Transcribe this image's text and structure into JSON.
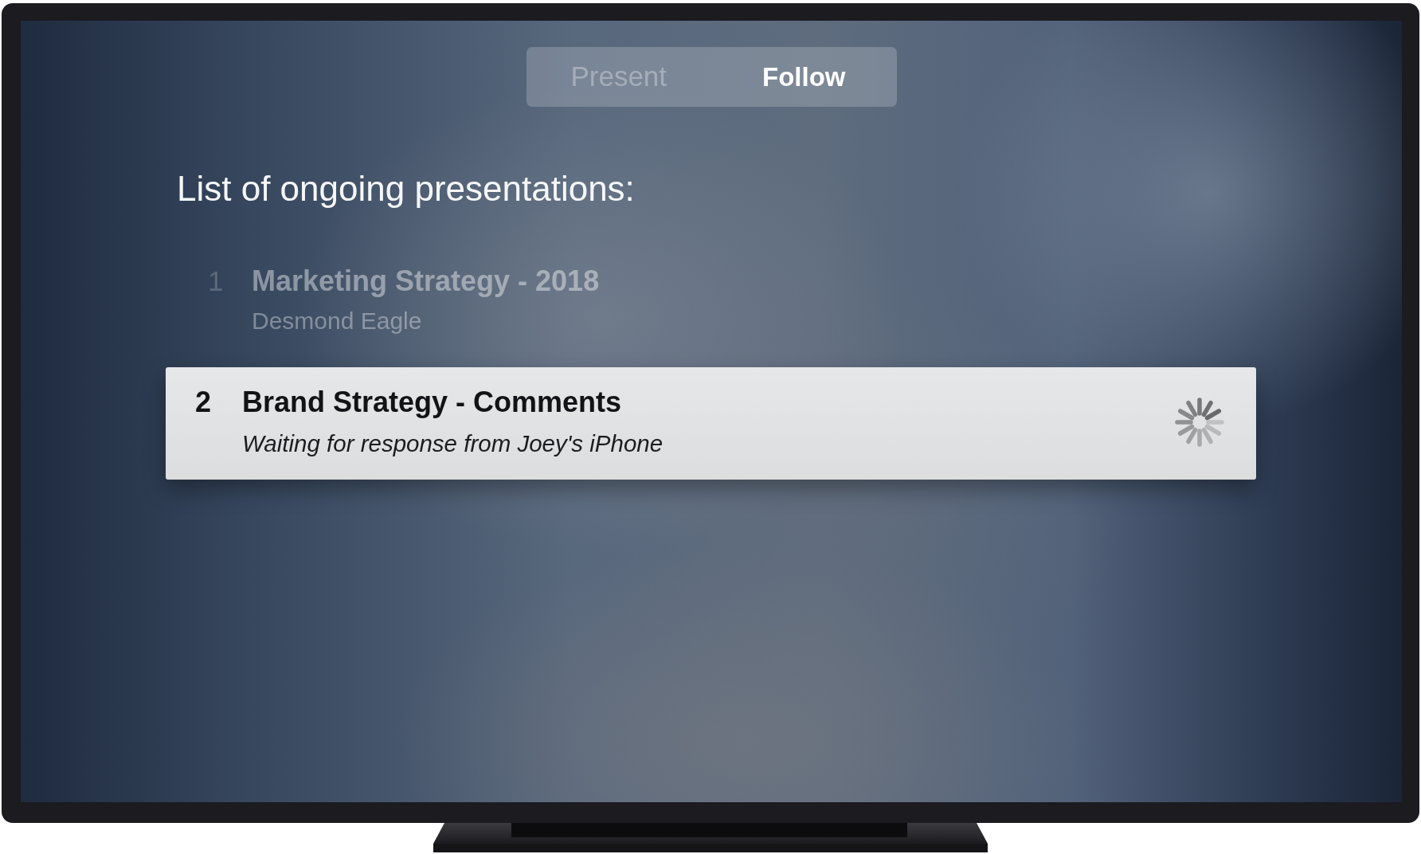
{
  "tabs": [
    {
      "label": "Present",
      "selected": false
    },
    {
      "label": "Follow",
      "selected": true
    }
  ],
  "heading": "List of ongoing presentations:",
  "presentations": [
    {
      "number": "1",
      "title": "Marketing Strategy - 2018",
      "presenter": "Desmond Eagle",
      "selected": false,
      "loading": false
    },
    {
      "number": "2",
      "title": "Brand Strategy - Comments",
      "status": "Waiting for response from Joey's iPhone",
      "selected": true,
      "loading": true
    }
  ]
}
